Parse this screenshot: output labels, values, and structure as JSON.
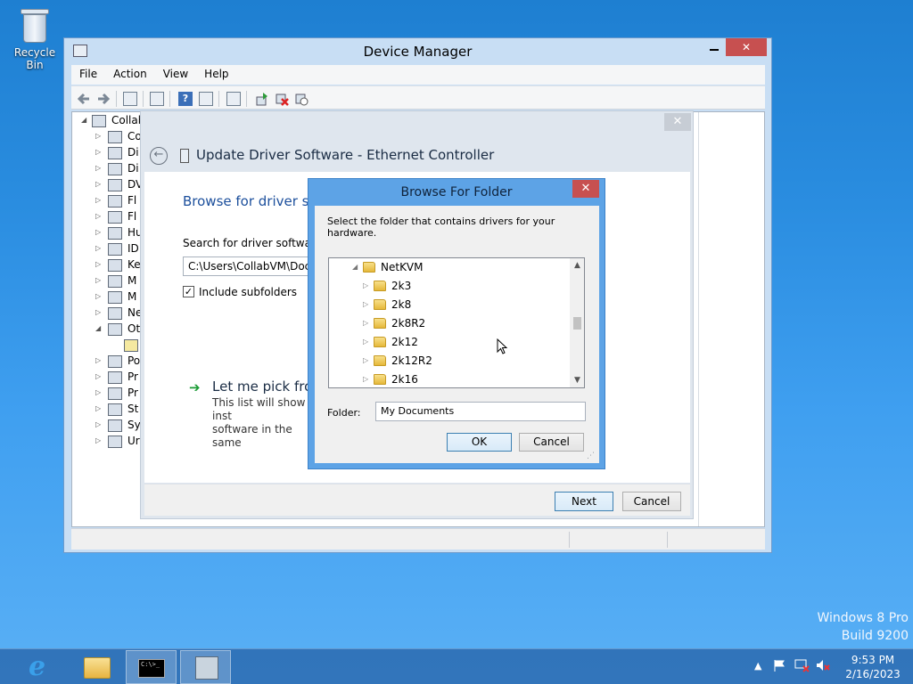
{
  "desktop": {
    "recycle_bin_label": "Recycle Bin",
    "watermark": [
      "Windows 8 Pro",
      "Build 9200"
    ]
  },
  "device_manager": {
    "title": "Device Manager",
    "close_glyph": "✕",
    "menu": [
      "File",
      "Action",
      "View",
      "Help"
    ],
    "tree": {
      "root_label": "Collab",
      "items": [
        "Co",
        "Di",
        "Di",
        "DV",
        "Fl",
        "Fl",
        "Hu",
        "ID",
        "Ke",
        "M",
        "M",
        "Ne",
        "Ot",
        "",
        "Po",
        "Pr",
        "Pr",
        "St",
        "Sy",
        "Ur"
      ]
    }
  },
  "update_driver": {
    "title": "Update Driver Software - Ethernet Controller",
    "heading": "Browse for driver sof",
    "search_label": "Search for driver software in",
    "path_value": "C:\\Users\\CollabVM\\Docum",
    "include_subfolders_label": "Include subfolders",
    "include_subfolders_checked": true,
    "check_glyph": "✓",
    "pick_title": "Let me pick from",
    "pick_desc_line1": "This list will show inst",
    "pick_desc_line2": "software in the same",
    "next_label": "Next",
    "cancel_label": "Cancel"
  },
  "browse_folder": {
    "title": "Browse For Folder",
    "description": "Select the folder that contains drivers for your hardware.",
    "parent_folder": "NetKVM",
    "subfolders": [
      "2k3",
      "2k8",
      "2k8R2",
      "2k12",
      "2k12R2",
      "2k16"
    ],
    "folder_label": "Folder:",
    "folder_value": "My Documents",
    "ok_label": "OK",
    "cancel_label": "Cancel"
  },
  "taskbar": {
    "time": "9:53 PM",
    "date": "2/16/2023",
    "cmd_prompt_text": "C:\\>_"
  }
}
